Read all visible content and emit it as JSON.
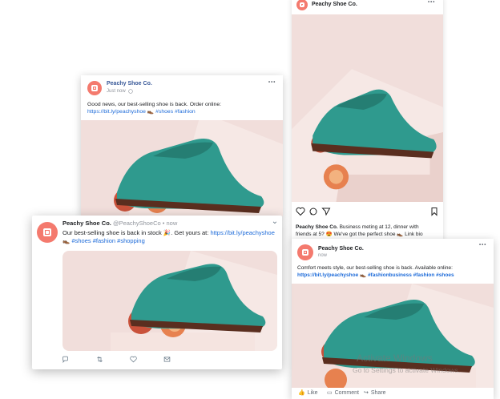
{
  "brand": {
    "name": "Peachy Shoe Co.",
    "handle": "@PeachyShoeCo",
    "accent": "#f47a6e",
    "link_color": "#1d6bd9"
  },
  "facebook_post": {
    "name": "Peachy Shoe Co.",
    "time": "Just now",
    "text": "Good news, our best-selling shoe is back. Order online:",
    "link": "https://bit.ly/peachyshoe",
    "emoji": "👞",
    "hashtags": "#shoes #fashion",
    "menu": "•••"
  },
  "instagram_post": {
    "name": "Peachy Shoe Co.",
    "menu": "•••",
    "caption_name": "Peachy Shoe Co.",
    "caption_text": "Business meting at 12, dinner with",
    "caption_line2": "friends at 5? 😍 We've got the perfect shoe 👞 Link bio"
  },
  "twitter_post": {
    "name": "Peachy Shoe Co.",
    "handle_time": "@PeachyShoeCo • now",
    "text": "Our best-selling shoe is back in stock 🎉. Get yours at:",
    "link": "https://bit.ly/peachyshoe",
    "hashtags_emoji": "👞",
    "hashtags": "#shoes #fashion #shopping",
    "chevron": "⌄"
  },
  "linkedin_post": {
    "name": "Peachy Shoe Co.",
    "time": "now",
    "text": "Comfort meets style, our best-selling shoe is back. Available online:",
    "link": "https://bit.ly/peachyshoe",
    "emoji": "👞",
    "hashtags": "#fashionbusiness #fashion #shoes",
    "menu": "•••",
    "actions": {
      "like": "Like",
      "comment": "Comment",
      "share": "Share"
    }
  },
  "watermark": {
    "line1": "Activate Windows",
    "line2": "Go to Settings to activate Windows."
  }
}
